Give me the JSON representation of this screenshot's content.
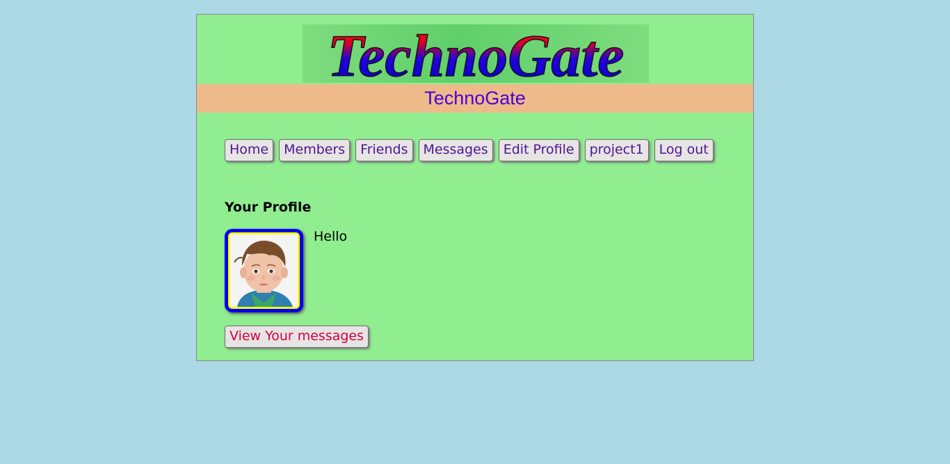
{
  "header": {
    "logo_text": "TechnoGate",
    "app_name": "TechnoGate"
  },
  "menu": {
    "items": [
      {
        "label": "Home"
      },
      {
        "label": "Members"
      },
      {
        "label": "Friends"
      },
      {
        "label": "Messages"
      },
      {
        "label": "Edit Profile"
      },
      {
        "label": "project1"
      },
      {
        "label": "Log out"
      }
    ]
  },
  "profile": {
    "heading": "Your Profile",
    "text": "Hello",
    "view_messages_label": "View Your messages"
  },
  "colors": {
    "page_background": "#add8e6",
    "content_background": "#90ee90",
    "appname_bar": "#eeba8a",
    "appname_text": "#4b00d6",
    "menu_text": "#4c1690",
    "messages_link_text": "#d0003f",
    "avatar_border": "#0000f0",
    "avatar_inner": "#ffff00"
  }
}
